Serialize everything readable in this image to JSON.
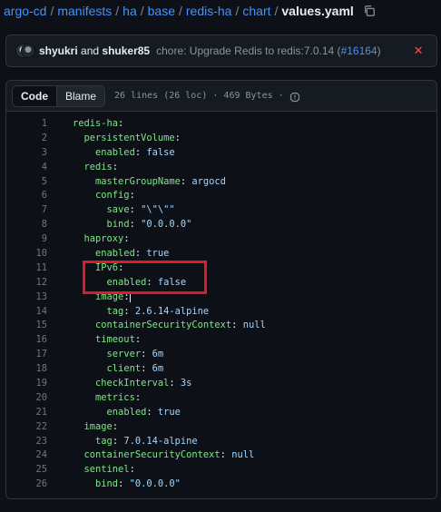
{
  "breadcrumb": {
    "parts": [
      "argo-cd",
      "manifests",
      "ha",
      "base",
      "redis-ha",
      "chart"
    ],
    "separator": "/",
    "current": "values.yaml"
  },
  "commit": {
    "author1": "shyukri",
    "and": "and",
    "author2": "shuker85",
    "message": "chore: Upgrade Redis to redis:7.0.14 (",
    "pr": "#16164",
    "message_end": ")",
    "status": "✕"
  },
  "file_header": {
    "code_tab": "Code",
    "blame_tab": "Blame",
    "meta": "26 lines (26 loc) · 469 Bytes ·"
  },
  "code_lines": [
    {
      "n": "1",
      "indent": "",
      "key": "redis-ha",
      "value": ""
    },
    {
      "n": "2",
      "indent": "  ",
      "key": "persistentVolume",
      "value": ""
    },
    {
      "n": "3",
      "indent": "    ",
      "key": "enabled",
      "value": "false"
    },
    {
      "n": "4",
      "indent": "  ",
      "key": "redis",
      "value": ""
    },
    {
      "n": "5",
      "indent": "    ",
      "key": "masterGroupName",
      "value": "argocd"
    },
    {
      "n": "6",
      "indent": "    ",
      "key": "config",
      "value": ""
    },
    {
      "n": "7",
      "indent": "      ",
      "key": "save",
      "value": "\"\\\"\\\"\""
    },
    {
      "n": "8",
      "indent": "      ",
      "key": "bind",
      "value": "\"0.0.0.0\""
    },
    {
      "n": "9",
      "indent": "  ",
      "key": "haproxy",
      "value": ""
    },
    {
      "n": "10",
      "indent": "    ",
      "key": "enabled",
      "value": "true"
    },
    {
      "n": "11",
      "indent": "    ",
      "key": "IPv6",
      "value": ""
    },
    {
      "n": "12",
      "indent": "      ",
      "key": "enabled",
      "value": "false"
    },
    {
      "n": "13",
      "indent": "    ",
      "key": "image",
      "value": ""
    },
    {
      "n": "14",
      "indent": "      ",
      "key": "tag",
      "value": "2.6.14-alpine"
    },
    {
      "n": "15",
      "indent": "    ",
      "key": "containerSecurityContext",
      "value": "null"
    },
    {
      "n": "16",
      "indent": "    ",
      "key": "timeout",
      "value": ""
    },
    {
      "n": "17",
      "indent": "      ",
      "key": "server",
      "value": "6m"
    },
    {
      "n": "18",
      "indent": "      ",
      "key": "client",
      "value": "6m"
    },
    {
      "n": "19",
      "indent": "    ",
      "key": "checkInterval",
      "value": "3s"
    },
    {
      "n": "20",
      "indent": "    ",
      "key": "metrics",
      "value": ""
    },
    {
      "n": "21",
      "indent": "      ",
      "key": "enabled",
      "value": "true"
    },
    {
      "n": "22",
      "indent": "  ",
      "key": "image",
      "value": ""
    },
    {
      "n": "23",
      "indent": "    ",
      "key": "tag",
      "value": "7.0.14-alpine"
    },
    {
      "n": "24",
      "indent": "  ",
      "key": "containerSecurityContext",
      "value": "null"
    },
    {
      "n": "25",
      "indent": "  ",
      "key": "sentinel",
      "value": ""
    },
    {
      "n": "26",
      "indent": "    ",
      "key": "bind",
      "value": "\"0.0.0.0\""
    }
  ],
  "cursor_line": "13",
  "colors": {
    "link": "#4493f8",
    "yaml_key": "#7ee787",
    "yaml_value": "#a5d6ff",
    "annotation_box": "#e11a25"
  },
  "icons": {
    "copy": "copy-icon",
    "info": "info-icon",
    "status": "x-icon"
  }
}
